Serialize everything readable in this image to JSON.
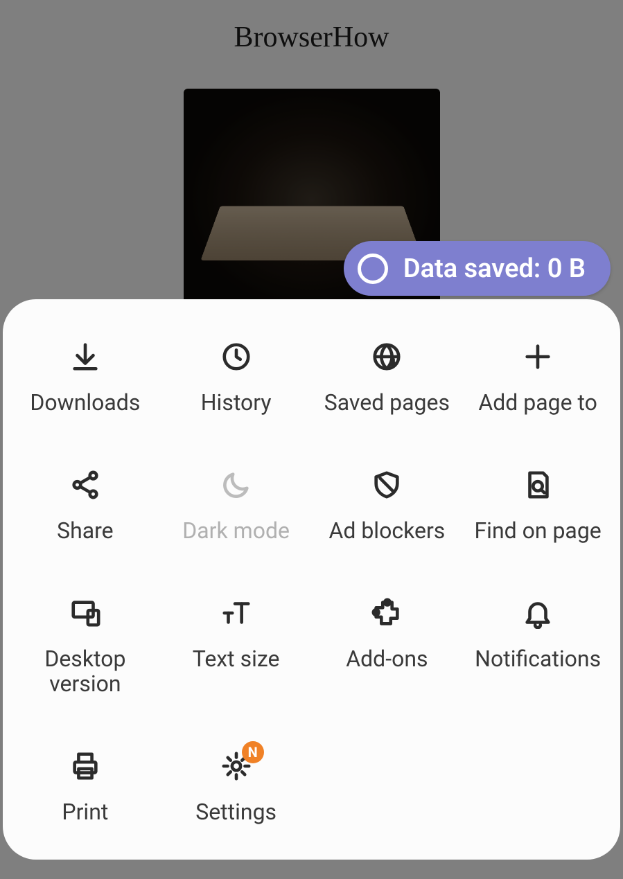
{
  "page": {
    "title": "BrowserHow"
  },
  "pill": {
    "label": "Data saved: 0 B"
  },
  "menu": {
    "items": [
      {
        "label": "Downloads"
      },
      {
        "label": "History"
      },
      {
        "label": "Saved pages"
      },
      {
        "label": "Add page to"
      },
      {
        "label": "Share"
      },
      {
        "label": "Dark mode"
      },
      {
        "label": "Ad blockers"
      },
      {
        "label": "Find on page"
      },
      {
        "label": "Desktop version"
      },
      {
        "label": "Text size"
      },
      {
        "label": "Add-ons"
      },
      {
        "label": "Notifications"
      },
      {
        "label": "Print"
      },
      {
        "label": "Settings",
        "badge": "N"
      }
    ]
  }
}
